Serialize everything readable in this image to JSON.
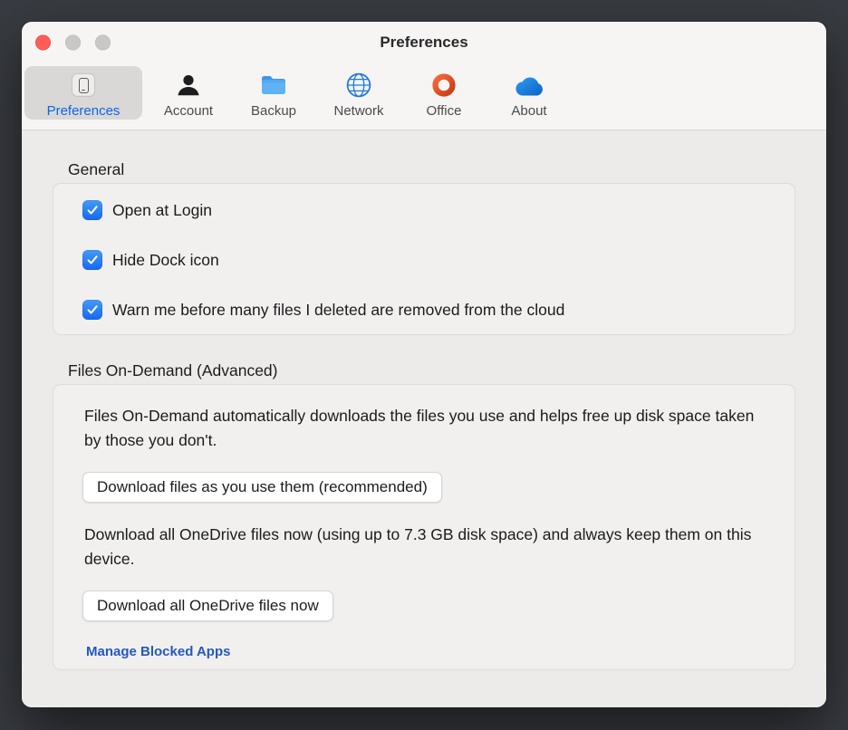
{
  "window": {
    "title": "Preferences"
  },
  "titlebar": {
    "traffic_lights": [
      "close",
      "minimize",
      "zoom"
    ]
  },
  "toolbar": {
    "tabs": [
      {
        "label": "Preferences",
        "icon": "device-icon",
        "selected": true
      },
      {
        "label": "Account",
        "icon": "person-icon",
        "selected": false
      },
      {
        "label": "Backup",
        "icon": "folder-icon",
        "selected": false
      },
      {
        "label": "Network",
        "icon": "globe-icon",
        "selected": false
      },
      {
        "label": "Office",
        "icon": "office-logo-icon",
        "selected": false
      },
      {
        "label": "About",
        "icon": "onedrive-cloud-icon",
        "selected": false
      }
    ]
  },
  "general": {
    "heading": "General",
    "checkboxes": [
      {
        "label": "Open at Login",
        "checked": true
      },
      {
        "label": "Hide Dock icon",
        "checked": true
      },
      {
        "label": "Warn me before many files I deleted are removed from the cloud",
        "checked": true
      }
    ]
  },
  "files_on_demand": {
    "heading": "Files On-Demand (Advanced)",
    "description": "Files On-Demand automatically downloads the files you use and helps free up disk space taken by those you don't.",
    "download_as_used_button": "Download files as you use them (recommended)",
    "download_all_description": "Download all OneDrive files now (using up to 7.3 GB disk space) and always keep them on this device.",
    "download_all_button": "Download all OneDrive files now",
    "manage_blocked_apps_link": "Manage Blocked Apps"
  },
  "colors": {
    "accent_blue": "#0d66e8",
    "link_blue": "#2458bd",
    "checkbox_blue": "#1668f0",
    "folder_blue": "#58acf2",
    "office_red": "#d83b01",
    "close_red": "#ff5d55"
  }
}
